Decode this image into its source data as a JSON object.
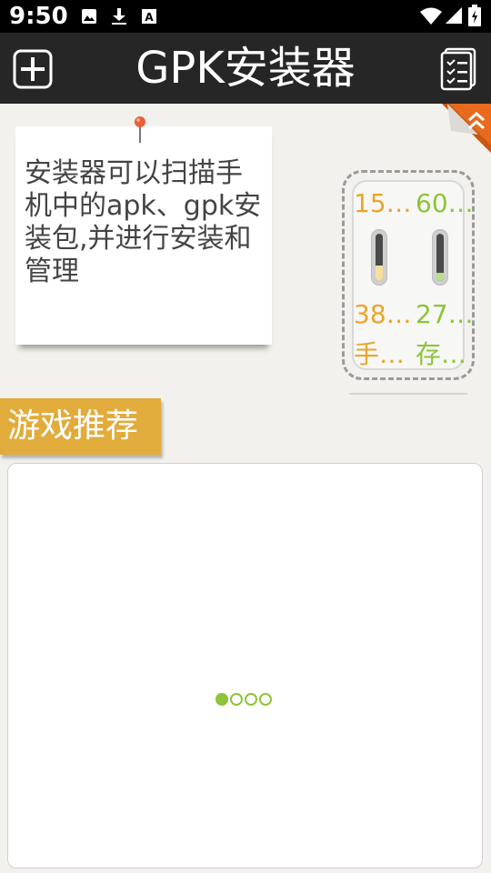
{
  "status_bar": {
    "time": "9:50",
    "icons": [
      "image-icon",
      "download-icon",
      "font-icon",
      "wifi-icon",
      "signal-icon",
      "battery-icon"
    ]
  },
  "app_bar": {
    "title": "GPK安装器",
    "add_icon": "plus-box-icon",
    "list_icon": "checklist-icon"
  },
  "intro_card": {
    "text": "安装器可以扫描手机中的apk、gpk安装包,并进行安装和管理"
  },
  "storage_widget": {
    "phone": {
      "top_value": "15…",
      "bottom_value": "38…",
      "label": "手…",
      "level": 0.33,
      "color": "#e8a62c",
      "fill_color": "#f3dfa0"
    },
    "storage": {
      "top_value": "60…",
      "bottom_value": "27…",
      "label": "存…",
      "level": 0.18,
      "color": "#8cc43a",
      "fill_color": "#b6e08a"
    }
  },
  "section": {
    "title": "游戏推荐"
  },
  "carousel": {
    "pages": 4,
    "active_index": 0
  }
}
